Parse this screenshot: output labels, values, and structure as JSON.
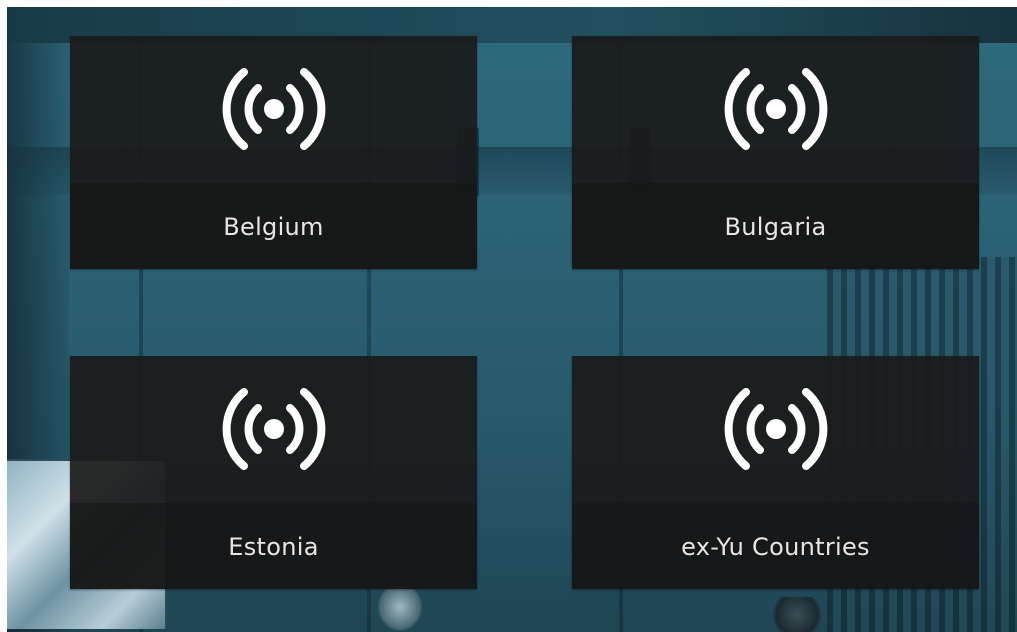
{
  "tiles": [
    {
      "label": "Belgium",
      "icon": "broadcast-icon"
    },
    {
      "label": "Bulgaria",
      "icon": "broadcast-icon"
    },
    {
      "label": "Estonia",
      "icon": "broadcast-icon"
    },
    {
      "label": "ex-Yu Countries",
      "icon": "broadcast-icon"
    }
  ],
  "colors": {
    "tile_background": "#1a1a1a",
    "label_text": "#e6e6e6",
    "icon": "#ffffff",
    "background": "#2b6174"
  }
}
